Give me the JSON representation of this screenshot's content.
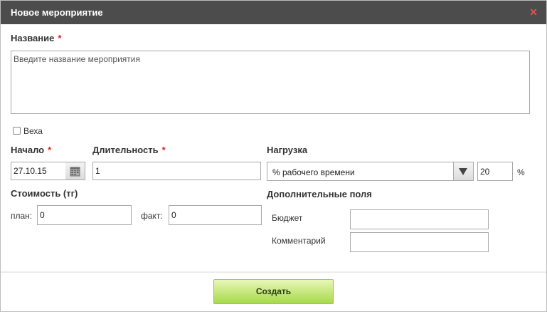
{
  "dialog": {
    "title": "Новое мероприятие",
    "close_glyph": "×"
  },
  "form": {
    "name": {
      "label": "Название",
      "required_mark": "*",
      "placeholder": "Введите название мероприятия",
      "value": ""
    },
    "milestone": {
      "label": "Веха",
      "checked": false
    },
    "start": {
      "label": "Начало",
      "required_mark": "*",
      "value": "27.10.15"
    },
    "duration": {
      "label": "Длительность",
      "required_mark": "*",
      "value": "1"
    },
    "load": {
      "label": "Нагрузка",
      "select_value": "% рабочего времени",
      "percent_value": "20",
      "unit": "%"
    },
    "cost": {
      "label": "Стоимость (тг)",
      "plan_label": "план:",
      "plan_value": "0",
      "fact_label": "факт:",
      "fact_value": "0"
    },
    "extra": {
      "label": "Дополнительные поля",
      "budget_label": "Бюджет",
      "budget_value": "",
      "comment_label": "Комментарий",
      "comment_value": ""
    }
  },
  "footer": {
    "create_label": "Создать"
  },
  "icons": {
    "close": "close-icon",
    "calendar": "calendar-icon",
    "dropdown": "chevron-down-icon"
  },
  "colors": {
    "titlebar": "#4c4c4c",
    "required": "#e02020",
    "close": "#d9534f",
    "button_green": "#a6d94a"
  }
}
